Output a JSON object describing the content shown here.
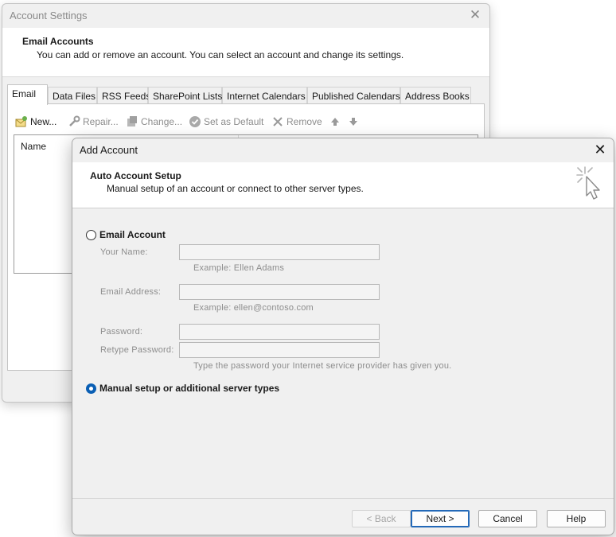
{
  "background_window": {
    "title": "Account Settings",
    "close_glyph": "✕",
    "header_title": "Email Accounts",
    "header_subtitle": "You can add or remove an account. You can select an account and change its settings.",
    "tabs": [
      {
        "label": "Email",
        "active": true
      },
      {
        "label": "Data Files"
      },
      {
        "label": "RSS Feeds"
      },
      {
        "label": "SharePoint Lists"
      },
      {
        "label": "Internet Calendars"
      },
      {
        "label": "Published Calendars"
      },
      {
        "label": "Address Books"
      }
    ],
    "toolbar": {
      "new_label": "New...",
      "repair_label": "Repair...",
      "change_label": "Change...",
      "set_default_label": "Set as Default",
      "remove_label": "Remove"
    },
    "list": {
      "column_name": "Name"
    }
  },
  "dialog": {
    "title": "Add Account",
    "close_glyph": "✕",
    "header_title": "Auto Account Setup",
    "header_subtitle": "Manual setup of an account or connect to other server types.",
    "email_account_option": "Email Account",
    "fields": {
      "your_name_label": "Your Name:",
      "your_name_value": "",
      "your_name_hint": "Example: Ellen Adams",
      "email_label": "Email Address:",
      "email_value": "",
      "email_hint": "Example: ellen@contoso.com",
      "password_label": "Password:",
      "retype_password_label": "Retype Password:",
      "password_hint": "Type the password your Internet service provider has given you."
    },
    "manual_setup_option": "Manual setup or additional server types",
    "selected_option": "manual",
    "buttons": {
      "back": "< Back",
      "next": "Next >",
      "cancel": "Cancel",
      "help": "Help"
    }
  },
  "colors": {
    "accent": "#0a5fb4",
    "window_bg": "#f0f0f0",
    "disabled_text": "#8d8d8d"
  },
  "icons": [
    "new-account-icon",
    "repair-icon",
    "change-icon",
    "set-default-icon",
    "remove-icon",
    "move-up-icon",
    "move-down-icon",
    "auto-setup-wizard-icon"
  ]
}
